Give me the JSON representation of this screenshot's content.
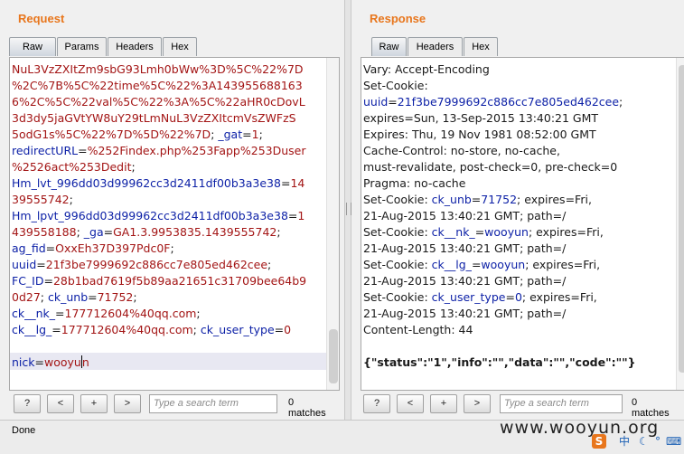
{
  "request": {
    "title": "Request",
    "tabs": [
      "Raw",
      "Params",
      "Headers",
      "Hex"
    ],
    "lines": [
      [
        [
          "v",
          "NuL3VzZXItZm9sbG93Lmh0bWw%3D%5C%22%7D"
        ]
      ],
      [
        [
          "v",
          "%2C%7B%5C%22time%5C%22%3A143955688163"
        ]
      ],
      [
        [
          "v",
          "6%2C%5C%22val%5C%22%3A%5C%22aHR0cDovL"
        ]
      ],
      [
        [
          "v",
          "3d3dy5jaGVtYW8uY29tLmNuL3VzZXItcmVsZWFzS"
        ]
      ],
      [
        [
          "v",
          "5odG1s%5C%22%7D%5D%22%7D"
        ],
        [
          "t",
          "; "
        ],
        [
          "k",
          "_gat"
        ],
        [
          "t",
          "="
        ],
        [
          "v",
          "1"
        ],
        [
          "t",
          ";"
        ]
      ],
      [
        [
          "k",
          "redirectURL"
        ],
        [
          "t",
          "="
        ],
        [
          "v",
          "%252Findex.php%253Fapp%253Duser"
        ]
      ],
      [
        [
          "v",
          "%2526act%253Dedit"
        ],
        [
          "t",
          ";"
        ]
      ],
      [
        [
          "k",
          "Hm_lvt_996dd03d99962cc3d2411df00b3a3e38"
        ],
        [
          "t",
          "="
        ],
        [
          "v",
          "14"
        ]
      ],
      [
        [
          "v",
          "39555742"
        ],
        [
          "t",
          ";"
        ]
      ],
      [
        [
          "k",
          "Hm_lpvt_996dd03d99962cc3d2411df00b3a3e38"
        ],
        [
          "t",
          "="
        ],
        [
          "v",
          "1"
        ]
      ],
      [
        [
          "v",
          "439558188"
        ],
        [
          "t",
          "; "
        ],
        [
          "k",
          "_ga"
        ],
        [
          "t",
          "="
        ],
        [
          "v",
          "GA1.3.9953835.1439555742"
        ],
        [
          "t",
          ";"
        ]
      ],
      [
        [
          "k",
          "ag_fid"
        ],
        [
          "t",
          "="
        ],
        [
          "v",
          "OxxEh37D397Pdc0F"
        ],
        [
          "t",
          ";"
        ]
      ],
      [
        [
          "k",
          "uuid"
        ],
        [
          "t",
          "="
        ],
        [
          "v",
          "21f3be7999692c886cc7e805ed462cee"
        ],
        [
          "t",
          ";"
        ]
      ],
      [
        [
          "k",
          "FC_ID"
        ],
        [
          "t",
          "="
        ],
        [
          "v",
          "28b1bad7619f5b89aa21651c31709bee64b9"
        ]
      ],
      [
        [
          "v",
          "0d27"
        ],
        [
          "t",
          "; "
        ],
        [
          "k",
          "ck_unb"
        ],
        [
          "t",
          "="
        ],
        [
          "v",
          "71752"
        ],
        [
          "t",
          ";"
        ]
      ],
      [
        [
          "k",
          "ck__nk_"
        ],
        [
          "t",
          "="
        ],
        [
          "v",
          "177712604%40qq.com"
        ],
        [
          "t",
          ";"
        ]
      ],
      [
        [
          "k",
          "ck__lg_"
        ],
        [
          "t",
          "="
        ],
        [
          "v",
          "177712604%40qq.com"
        ],
        [
          "t",
          "; "
        ],
        [
          "k",
          "ck_user_type"
        ],
        [
          "t",
          "="
        ],
        [
          "v",
          "0"
        ]
      ],
      [
        [
          "t",
          ""
        ]
      ],
      [
        [
          "k",
          "nick"
        ],
        [
          "t",
          "="
        ],
        [
          "v",
          "wooyu"
        ],
        [
          "c",
          ""
        ],
        [
          "v",
          "n"
        ]
      ]
    ],
    "search_placeholder": "Type a search term",
    "matches": "0 matches",
    "buttons": [
      "?",
      "<",
      "+",
      ">"
    ]
  },
  "response": {
    "title": "Response",
    "tabs": [
      "Raw",
      "Headers",
      "Hex"
    ],
    "lines": [
      [
        [
          "t",
          "Vary: Accept-Encoding"
        ]
      ],
      [
        [
          "t",
          "Set-Cookie:"
        ]
      ],
      [
        [
          "k",
          "uuid"
        ],
        [
          "t",
          "="
        ],
        [
          "k",
          "21f3be7999692c886cc7e805ed462cee"
        ],
        [
          "t",
          ";"
        ]
      ],
      [
        [
          "t",
          "expires=Sun, 13-Sep-2015 13:40:21 GMT"
        ]
      ],
      [
        [
          "t",
          "Expires: Thu, 19 Nov 1981 08:52:00 GMT"
        ]
      ],
      [
        [
          "t",
          "Cache-Control: no-store, no-cache,"
        ]
      ],
      [
        [
          "t",
          "must-revalidate, post-check=0, pre-check=0"
        ]
      ],
      [
        [
          "t",
          "Pragma: no-cache"
        ]
      ],
      [
        [
          "t",
          "Set-Cookie: "
        ],
        [
          "k",
          "ck_unb"
        ],
        [
          "t",
          "="
        ],
        [
          "k",
          "71752"
        ],
        [
          "t",
          "; expires=Fri,"
        ]
      ],
      [
        [
          "t",
          "21-Aug-2015 13:40:21 GMT; path=/"
        ]
      ],
      [
        [
          "t",
          "Set-Cookie: "
        ],
        [
          "k",
          "ck__nk_"
        ],
        [
          "t",
          "="
        ],
        [
          "k",
          "wooyun"
        ],
        [
          "t",
          "; expires=Fri,"
        ]
      ],
      [
        [
          "t",
          "21-Aug-2015 13:40:21 GMT; path=/"
        ]
      ],
      [
        [
          "t",
          "Set-Cookie: "
        ],
        [
          "k",
          "ck__lg_"
        ],
        [
          "t",
          "="
        ],
        [
          "k",
          "wooyun"
        ],
        [
          "t",
          "; expires=Fri,"
        ]
      ],
      [
        [
          "t",
          "21-Aug-2015 13:40:21 GMT; path=/"
        ]
      ],
      [
        [
          "t",
          "Set-Cookie: "
        ],
        [
          "k",
          "ck_user_type"
        ],
        [
          "t",
          "="
        ],
        [
          "k",
          "0"
        ],
        [
          "t",
          "; expires=Fri,"
        ]
      ],
      [
        [
          "t",
          "21-Aug-2015 13:40:21 GMT; path=/"
        ]
      ],
      [
        [
          "t",
          "Content-Length: 44"
        ]
      ],
      [
        [
          "t",
          ""
        ]
      ],
      [
        [
          "b",
          "{\"status\":\"1\",\"info\":\"\",\"data\":\"\",\"code\":\"\"}"
        ]
      ]
    ],
    "search_placeholder": "Type a search term",
    "matches": "0 matches",
    "buttons": [
      "?",
      "<",
      "+",
      ">"
    ]
  },
  "status": {
    "text": "Done"
  },
  "watermark": {
    "text": "www.wooyun.org"
  },
  "tray_icons": [
    "sogou-s-icon",
    "chinese-char-icon",
    "moon-icon",
    "dot-icon",
    "keyboard-icon"
  ],
  "tray_labels": [
    "S",
    "中",
    "☾",
    "°",
    "⌨"
  ],
  "colors": {
    "accent": "#e8761c",
    "key": "#0b1fa6",
    "value": "#a31515"
  }
}
